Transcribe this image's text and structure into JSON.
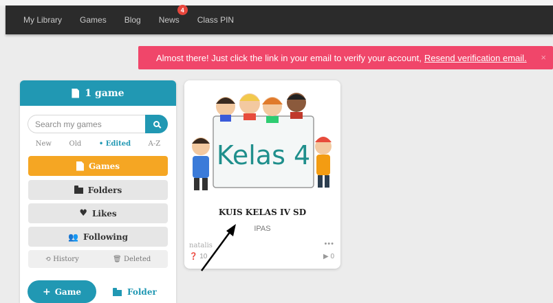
{
  "nav": {
    "items": [
      {
        "label": "My Library"
      },
      {
        "label": "Games"
      },
      {
        "label": "Blog"
      },
      {
        "label": "News",
        "badge": "4"
      },
      {
        "label": "Class PIN"
      }
    ]
  },
  "alert": {
    "message": "Almost there! Just click the link in your email to verify your account,",
    "link": "Resend verification email.",
    "close": "×"
  },
  "library": {
    "header": "1 game",
    "search_placeholder": "Search my games",
    "sort": [
      "New",
      "Old",
      "• Edited",
      "A-Z"
    ],
    "menu": {
      "games": "Games",
      "folders": "Folders",
      "likes": "Likes",
      "following": "Following"
    },
    "history": "History",
    "deleted": "Deleted",
    "add_game": "Game",
    "add_folder": "Folder"
  },
  "game_card": {
    "image_text": "Kelas 4",
    "title": "KUIS KELAS IV SD",
    "subject": "IPAS",
    "author": "natalis",
    "questions": "10",
    "plays": "0"
  },
  "colors": {
    "accent": "#2198b3",
    "games_button": "#f5a623",
    "alert": "#f0466a",
    "navbar": "#2b2b2b"
  }
}
